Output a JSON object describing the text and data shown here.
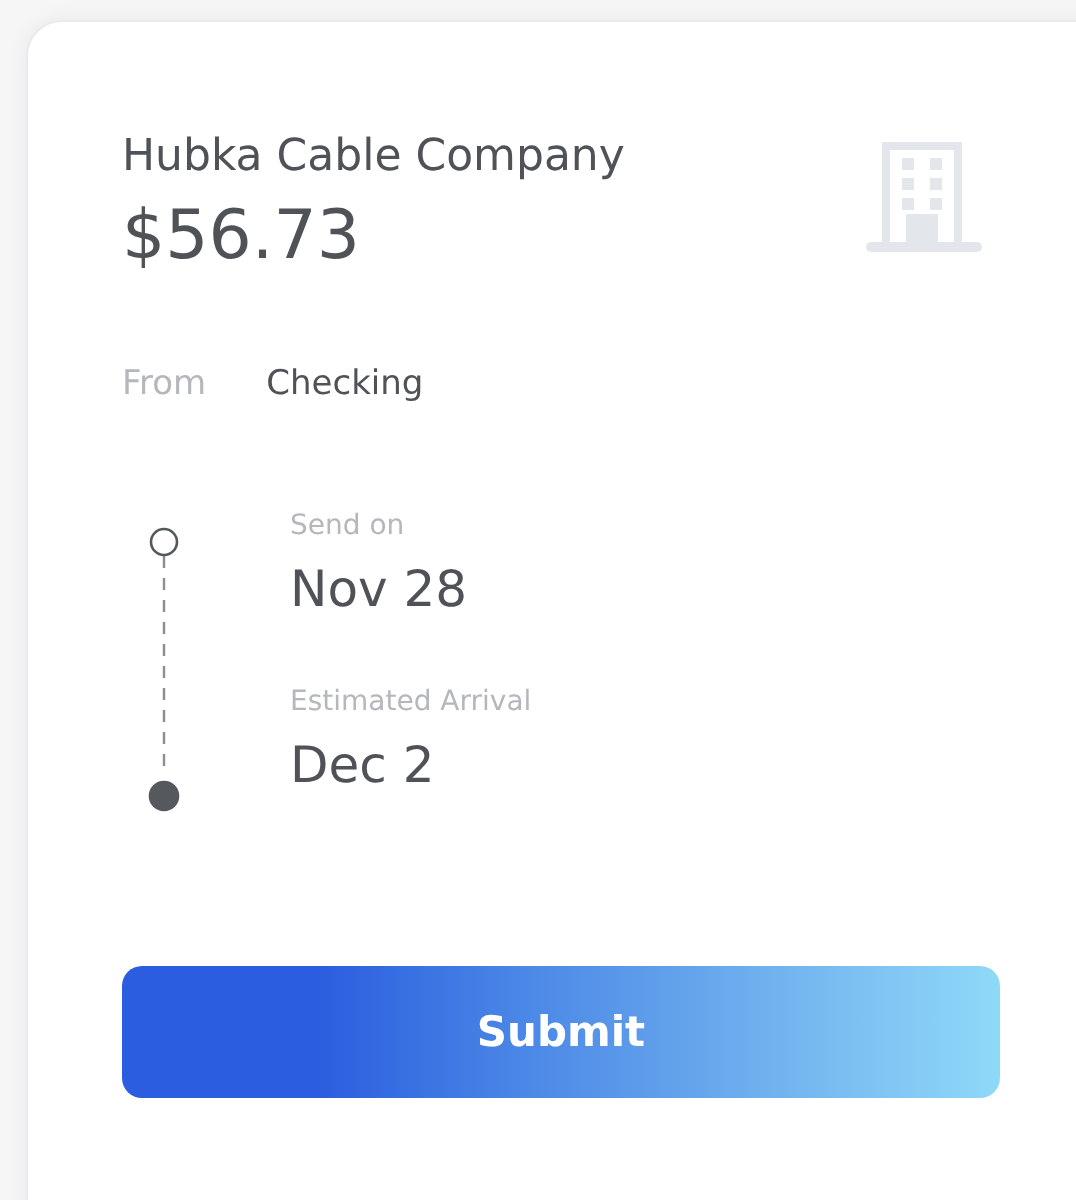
{
  "payee": {
    "name": "Hubka Cable Company",
    "amount": "$56.73"
  },
  "source": {
    "label": "From",
    "value": "Checking"
  },
  "timeline": [
    {
      "label": "Send on",
      "date": "Nov 28",
      "filled": false
    },
    {
      "label": "Estimated Arrival",
      "date": "Dec 2",
      "filled": true
    }
  ],
  "button": {
    "label": "Submit"
  }
}
